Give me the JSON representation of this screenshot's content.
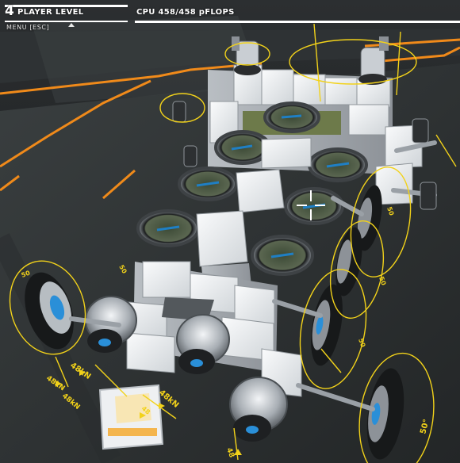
{
  "hud": {
    "player_level_number": "4",
    "player_level_label": "PLAYER LEVEL",
    "player_level_progress": 1.0,
    "cpu_label": "CPU 458/458 pFLOPS",
    "cpu_used": 458,
    "cpu_max": 458,
    "menu_hint": "MENU [ESC]"
  },
  "gizmo_labels": {
    "thruster_left_1": "48kN",
    "thruster_left_2": "48kN",
    "thruster_left_3": "48kN",
    "thruster_front": "48kN",
    "thruster_small_a": "48",
    "thruster_small_b": "48",
    "wheel_right_1": "50",
    "wheel_right_2": "50",
    "wheel_right_3": "50",
    "wheel_right_4": "50°",
    "wheel_left": "50",
    "wheel_left_top": "50"
  },
  "colors": {
    "accent_orange": "#f08a1a",
    "gizmo_yellow": "#f2d21a",
    "block_white": "#e9ecef",
    "thruster_blue": "#2a8fd8",
    "hud_white": "#ffffff"
  }
}
